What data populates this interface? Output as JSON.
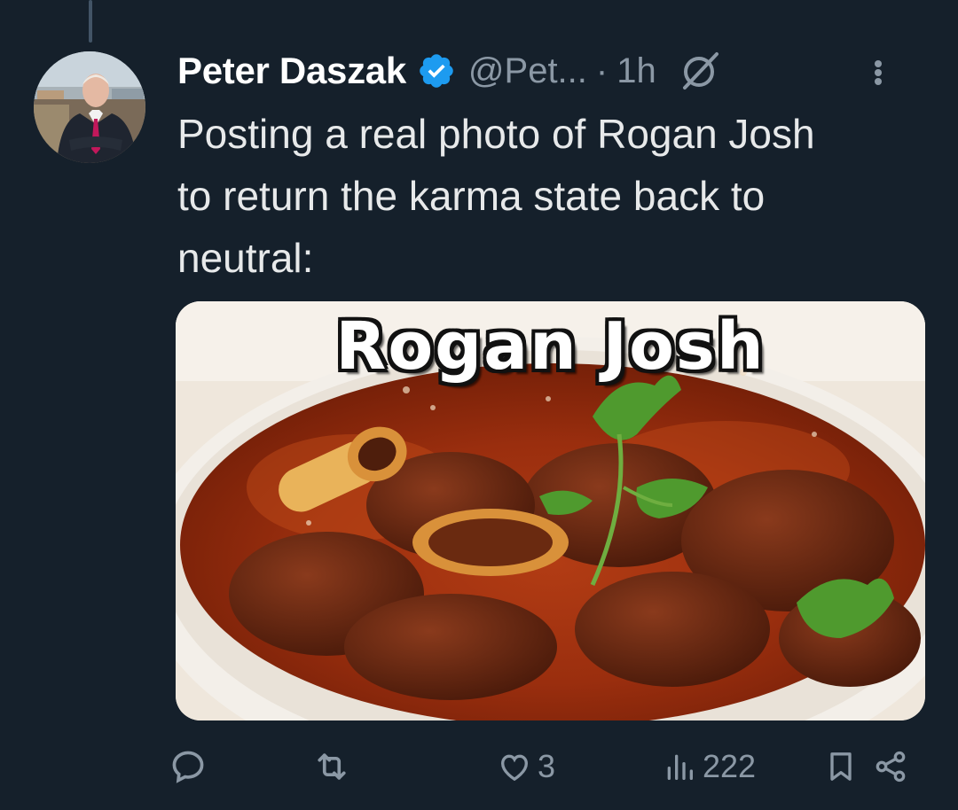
{
  "tweet": {
    "author_name": "Peter Daszak",
    "handle": "@Pet...",
    "separator": "·",
    "time": "1h",
    "text": "Posting a real photo of Rogan Josh\nto return the karma state back to\nneutral:",
    "media_caption": "Rogan Josh"
  },
  "actions": {
    "reply_count": "",
    "retweet_count": "",
    "like_count": "3",
    "views_count": "222"
  },
  "icons": {
    "verified": "verified-badge-icon",
    "grok": "grok-icon",
    "more": "more-options-icon",
    "reply": "reply-icon",
    "retweet": "retweet-icon",
    "like": "heart-icon",
    "views": "views-icon",
    "bookmark": "bookmark-icon",
    "share": "share-icon"
  },
  "colors": {
    "background": "#15202b",
    "text": "#e7e9ea",
    "muted": "#8b98a5",
    "verified": "#1d9bf0"
  }
}
